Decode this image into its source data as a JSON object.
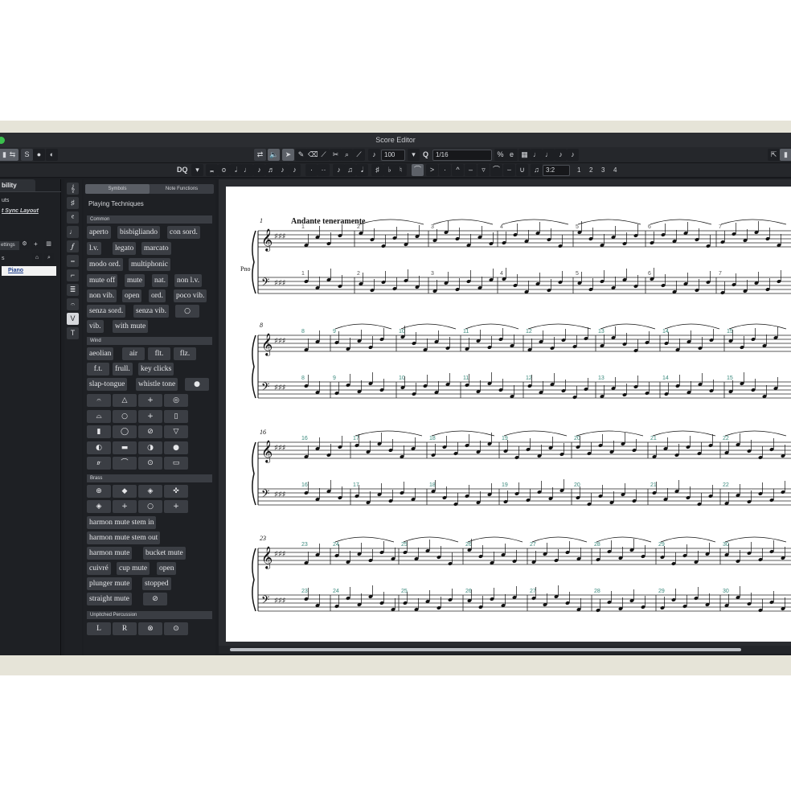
{
  "window": {
    "title": "Score Editor"
  },
  "toolbar1": {
    "velocity_value": "100",
    "quantize_value": "1/16",
    "quantize_label": "Q"
  },
  "toolbar2": {
    "display_quantize_label": "DQ",
    "tuplet_value": "3:2",
    "voice_numbers": [
      "1",
      "2",
      "3",
      "4"
    ]
  },
  "left_panel": {
    "tab_label": "bility",
    "line1": "uts",
    "line2": "t Sync Layout",
    "settings_label": "ettings",
    "tracks_label": "s",
    "instrument_track": "Piano"
  },
  "symbols_panel": {
    "tab_symbols": "Symbols",
    "tab_note_functions": "Note Functions",
    "heading": "Playing Techniques",
    "sections": {
      "common": "Common",
      "wind": "Wind",
      "brass": "Brass",
      "unpitched": "Unpitched Percussion"
    },
    "common_items": [
      "aperto",
      "bisbigliando",
      "con sord.",
      "l.v.",
      "legato",
      "marcato",
      "modo ord.",
      "multiphonic",
      "mute off",
      "mute",
      "nat.",
      "non l.v.",
      "non vib.",
      "open",
      "ord.",
      "poco vib.",
      "senza sord.",
      "senza vib.",
      "vib.",
      "with mute"
    ],
    "wind_items": [
      "aeolian",
      "air",
      "flt.",
      "flz.",
      "f.t.",
      "frull.",
      "key clicks",
      "slap-tongue",
      "whistle tone"
    ],
    "brass_items": [
      "harmon mute stem in",
      "harmon mute stem out",
      "harmon mute",
      "bucket mute",
      "cuivré",
      "cup mute",
      "open",
      "plunger mute",
      "stopped",
      "straight mute"
    ],
    "percussion_items": [
      "L",
      "R"
    ]
  },
  "score": {
    "tempo_marking": "Andante teneramente",
    "instrument_abbrev": "Pno",
    "system_numbers": [
      "1",
      "8",
      "16",
      "23"
    ],
    "bar_numbers_sys1": [
      "1",
      "2",
      "3",
      "4",
      "5",
      "6",
      "7"
    ],
    "bar_numbers_sys2": [
      "8",
      "9",
      "10",
      "11",
      "12",
      "13",
      "14",
      "15"
    ],
    "bar_numbers_sys3": [
      "16",
      "17",
      "18",
      "19",
      "20",
      "21",
      "22"
    ],
    "bar_numbers_sys4": [
      "23",
      "24",
      "25",
      "26",
      "27",
      "28",
      "29",
      "30"
    ]
  },
  "colors": {
    "window_bg": "#1c1e22",
    "panel_bg": "#1e2024",
    "chip_bg": "#3b3e44",
    "bar_number": "#3b8a7e",
    "traffic_green": "#3bc04d"
  }
}
